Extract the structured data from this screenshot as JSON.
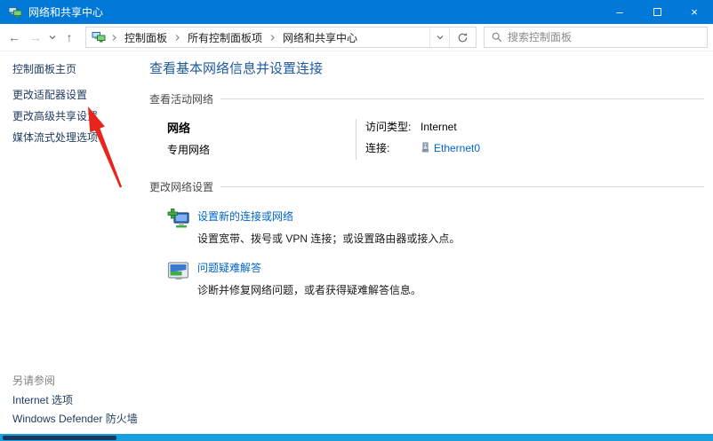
{
  "window": {
    "title": "网络和共享中心"
  },
  "icons": {
    "back": "←",
    "forward": "→",
    "up": "↑",
    "minimize": "–",
    "close": "×",
    "network_icon": "network-two-monitors",
    "new_connection_icon": "monitor-with-green-plus",
    "troubleshoot_icon": "monitor-with-status-bars",
    "ethernet_icon": "ethernet-connector"
  },
  "toolbar": {
    "breadcrumb": [
      "控制面板",
      "所有控制面板项",
      "网络和共享中心"
    ],
    "search": {
      "placeholder": "搜索控制面板",
      "value": ""
    }
  },
  "sidebar": {
    "home": "控制面板主页",
    "items": [
      {
        "label": "更改适配器设置"
      },
      {
        "label": "更改高级共享设置"
      },
      {
        "label": "媒体流式处理选项"
      }
    ],
    "see_also_header": "另请参阅",
    "see_also_items": [
      {
        "label": "Internet 选项"
      },
      {
        "label": "Windows Defender 防火墙"
      }
    ]
  },
  "main": {
    "title": "查看基本网络信息并设置连接",
    "active_networks": {
      "section_label": "查看活动网络",
      "network_name": "网络",
      "network_type": "专用网络",
      "access_type_label": "访问类型:",
      "access_type_value": "Internet",
      "connections_label": "连接:",
      "connections_value": "Ethernet0"
    },
    "change_settings": {
      "section_label": "更改网络设置",
      "tasks": [
        {
          "title": "设置新的连接或网络",
          "description": "设置宽带、拨号或 VPN 连接；或设置路由器或接入点。"
        },
        {
          "title": "问题疑难解答",
          "description": "诊断并修复网络问题，或者获得疑难解答信息。"
        }
      ]
    }
  },
  "annotation": {
    "type": "red-arrow",
    "points_at": "更改高级共享设置"
  },
  "colors": {
    "titlebar": "#0078d7",
    "link": "#0066cc",
    "heading": "#1d5aa0",
    "sidebar_text": "#1e3a5f",
    "arrow_red": "#e8251d",
    "taskbar_strip": "#18a0dc"
  }
}
